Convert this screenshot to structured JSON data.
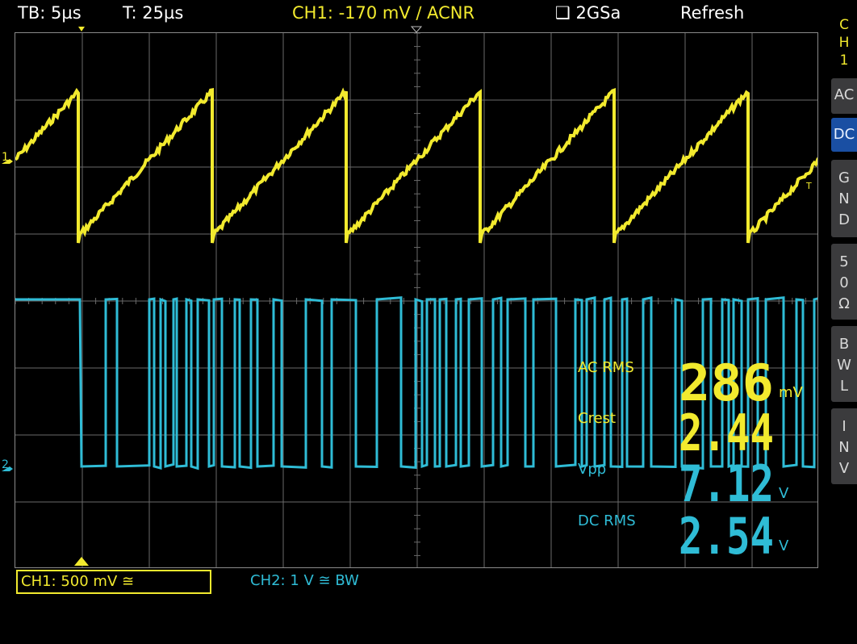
{
  "status_bar": {
    "timebase": "TB: 5µs",
    "trigger_time": "T: 25µs",
    "trigger": "CH1: -170 mV ∕ ACNR",
    "sample_rate": "2GSa",
    "mode": "Refresh"
  },
  "side_panel": {
    "channel_tab": "CH1",
    "buttons": [
      {
        "label": "AC",
        "active": false
      },
      {
        "label": "DC",
        "active": true
      },
      {
        "label": "GND",
        "active": false
      },
      {
        "label": "50Ω",
        "active": false
      },
      {
        "label": "BWL",
        "active": false
      },
      {
        "label": "INV",
        "active": false
      }
    ]
  },
  "channels": {
    "ch1": {
      "label": "CH1: 500 mV ≅",
      "color": "#f2ea2e",
      "marker": "1"
    },
    "ch2": {
      "label": "CH2: 1 V ≅ BW",
      "color": "#2fbcd6",
      "marker": "2"
    }
  },
  "trigger_level_marker": "T",
  "measurements": [
    {
      "label": "AC RMS",
      "value": "286",
      "unit": "mV",
      "color": "#f2ea2e"
    },
    {
      "label": "Crest",
      "value": "2.44",
      "unit": "",
      "color": "#f2ea2e"
    },
    {
      "label": "Vpp",
      "value": "7.12",
      "unit": "V",
      "color": "#2fbcd6"
    },
    {
      "label": "DC RMS",
      "value": "2.54",
      "unit": "V",
      "color": "#2fbcd6"
    }
  ],
  "colors": {
    "grid": "#6a6a6a",
    "background": "#000000",
    "ch1": "#f2ea2e",
    "ch2": "#2fbcd6"
  }
}
